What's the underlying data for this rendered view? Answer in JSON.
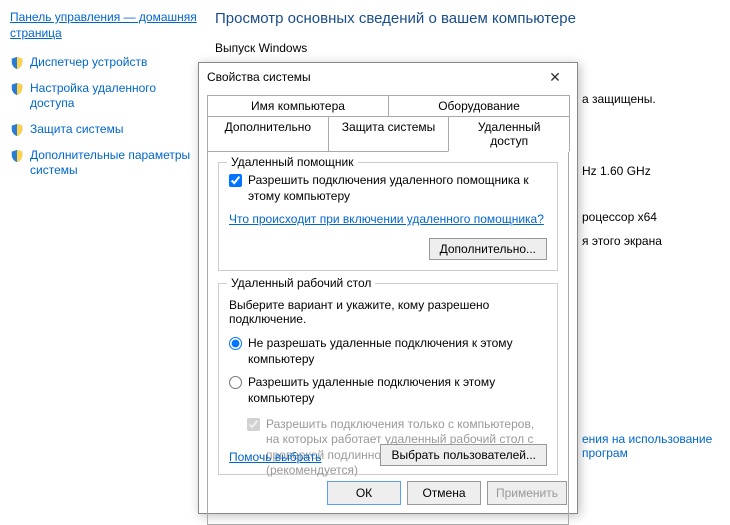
{
  "sidebar": {
    "home": "Панель управления — домашняя страница",
    "items": [
      {
        "label": "Диспетчер устройств"
      },
      {
        "label": "Настройка удаленного доступа"
      },
      {
        "label": "Защита системы"
      },
      {
        "label": "Дополнительные параметры системы"
      }
    ]
  },
  "main": {
    "heading": "Просмотр основных сведений о вашем компьютере",
    "edition_label": "Выпуск Windows",
    "rights_protected": "а защищены.",
    "cpu_suffix": "Hz  1.60 GHz",
    "proc_arch": "роцессор x64",
    "screen_suffix": "я этого экрана",
    "license_link": "ения на использование програм"
  },
  "dialog": {
    "title": "Свойства системы",
    "tabs": {
      "row1": [
        "Имя компьютера",
        "Оборудование"
      ],
      "row2": [
        "Дополнительно",
        "Защита системы",
        "Удаленный доступ"
      ]
    },
    "ra_group": {
      "title": "Удаленный помощник",
      "allow": "Разрешить подключения удаленного помощника к этому компьютеру",
      "help_link": "Что происходит при включении удаленного помощника?",
      "advanced_btn": "Дополнительно..."
    },
    "rd_group": {
      "title": "Удаленный рабочий стол",
      "desc": "Выберите вариант и укажите, кому разрешено подключение.",
      "opt_deny": "Не разрешать удаленные подключения к этому компьютеру",
      "opt_allow": "Разрешить удаленные подключения к этому компьютеру",
      "nla": "Разрешить подключения только с компьютеров, на которых работает удаленный рабочий стол с проверкой подлинности на уровне сети (рекомендуется)",
      "help_link": "Помочь выбрать",
      "select_users_btn": "Выбрать пользователей..."
    },
    "buttons": {
      "ok": "ОК",
      "cancel": "Отмена",
      "apply": "Применить"
    }
  }
}
